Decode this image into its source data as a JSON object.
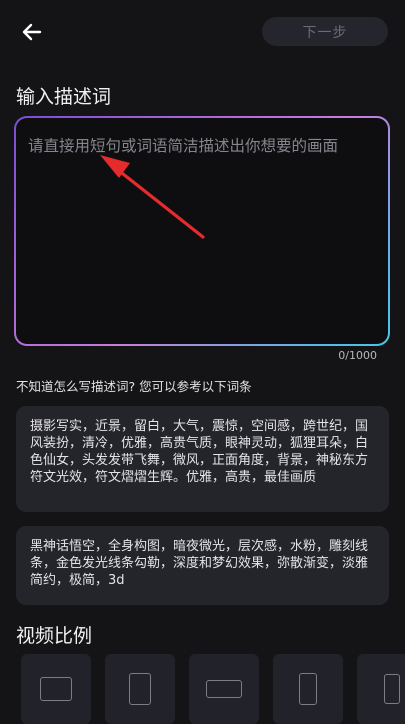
{
  "header": {
    "back_icon": "arrow-left-icon",
    "next_label": "下一步"
  },
  "prompt": {
    "title": "输入描述词",
    "placeholder": "请直接用短句或词语简洁描述出你想要的画面",
    "counter": "0/1000"
  },
  "references": {
    "hint": "不知道怎么写描述词? 您可以参考以下词条",
    "items": [
      "摄影写实，近景，留白，大气，震惊，空间感，跨世纪，国风装扮，清冷，优雅，高贵气质，眼神灵动，狐狸耳朵，白色仙女，头发发带飞舞，微风，正面角度，背景，神秘东方符文光效，符文熠熠生辉。优雅，高贵，最佳画质",
      "黑神话悟空，全身构图，暗夜微光，层次感，水粉，雕刻线条，金色发光线条勾勒，深度和梦幻效果，弥散渐变，淡雅简约，极简，3d"
    ]
  },
  "ratio": {
    "title": "视频比例",
    "options": [
      "landscape",
      "portrait",
      "wide",
      "tall",
      "vertical"
    ]
  },
  "colors": {
    "background": "#141416",
    "card": "#24242b",
    "gradient_start": "#7a4dd6",
    "gradient_end": "#47c7e8",
    "annotation_arrow": "#e52b2b"
  }
}
